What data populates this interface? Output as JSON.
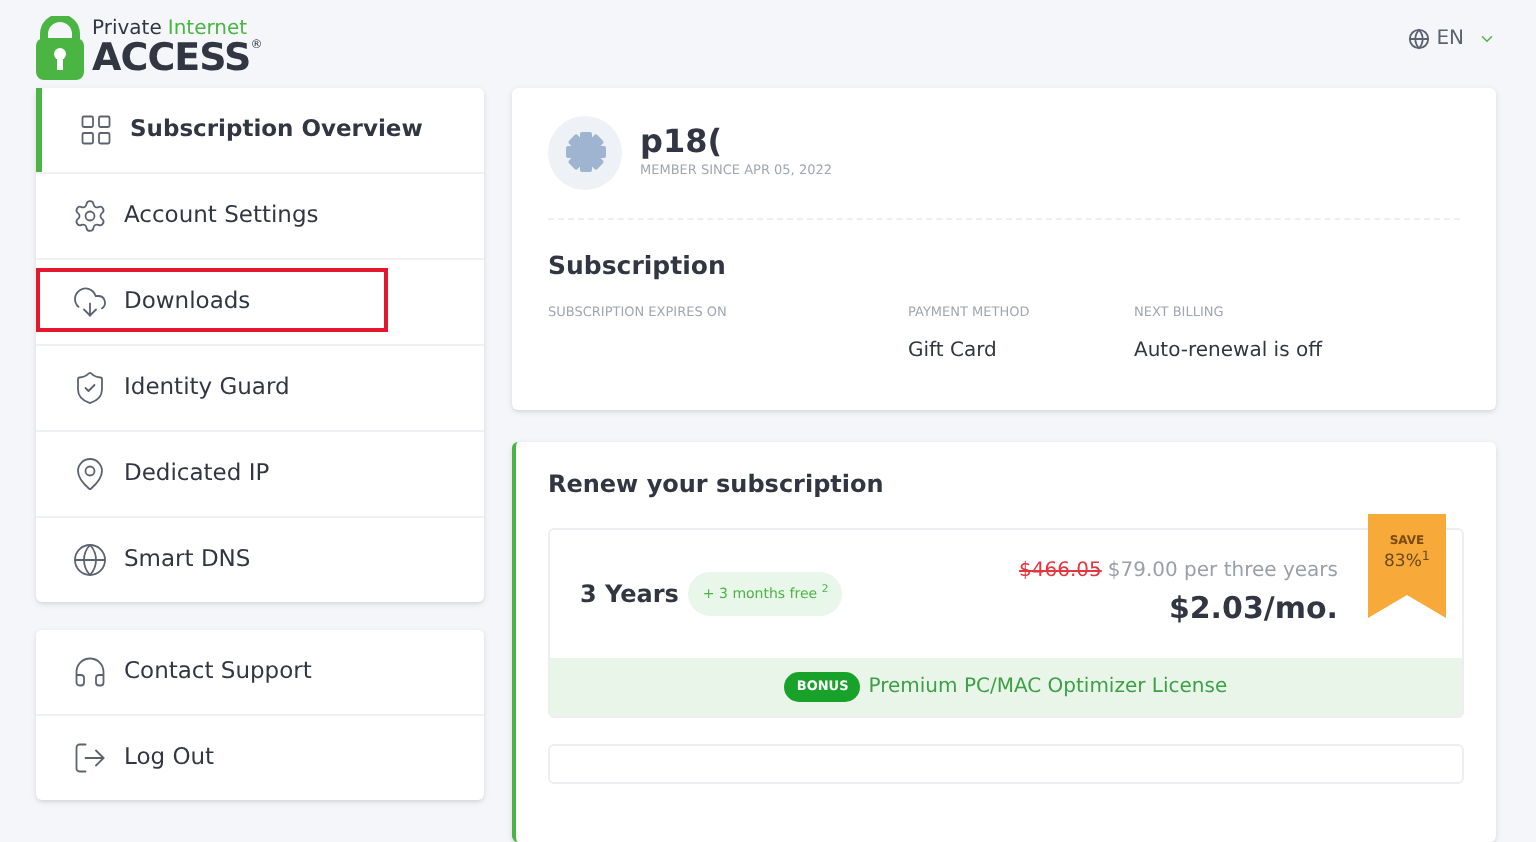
{
  "logo": {
    "line_1a": "Private",
    "line_1b": "Internet",
    "line_2": "ACCESS",
    "mark": "®"
  },
  "language": {
    "label": "EN"
  },
  "sidebar": {
    "groups": [
      {
        "items": [
          {
            "label": "Subscription Overview",
            "kind": "grid",
            "selected": true,
            "highlighted": false
          },
          {
            "label": "Account Settings",
            "kind": "gear",
            "selected": false,
            "highlighted": false
          },
          {
            "label": "Downloads",
            "kind": "download",
            "selected": false,
            "highlighted": true
          },
          {
            "label": "Identity Guard",
            "kind": "shield",
            "selected": false,
            "highlighted": false
          },
          {
            "label": "Dedicated IP",
            "kind": "pin",
            "selected": false,
            "highlighted": false
          },
          {
            "label": "Smart DNS",
            "kind": "globe",
            "selected": false,
            "highlighted": false
          }
        ]
      },
      {
        "items": [
          {
            "label": "Contact Support",
            "kind": "headset",
            "selected": false,
            "highlighted": false
          },
          {
            "label": "Log Out",
            "kind": "logout",
            "selected": false,
            "highlighted": false
          }
        ]
      }
    ]
  },
  "profile": {
    "username": "p18(",
    "member_since": "MEMBER SINCE APR 05, 2022"
  },
  "subscription": {
    "title": "Subscription",
    "fields": [
      {
        "label": "SUBSCRIPTION EXPIRES ON"
      },
      {
        "label": "PAYMENT METHOD",
        "value": "Gift Card"
      },
      {
        "label": "NEXT BILLING",
        "value": "Auto-renewal is off"
      }
    ]
  },
  "renew": {
    "title": "Renew your subscription",
    "plans": [
      {
        "name": "3 Years",
        "promo": "+ 3 months free $^{2}$",
        "old_price": "$466.05",
        "price_note": "$79.00 per three years",
        "monthly": "$2.03/mo.",
        "ribbon_title": "SAVE",
        "ribbon_value": "83%$^{1}$",
        "bonus_tag": "BONUS",
        "bonus_text": "Premium PC/MAC Optimizer License"
      }
    ]
  }
}
